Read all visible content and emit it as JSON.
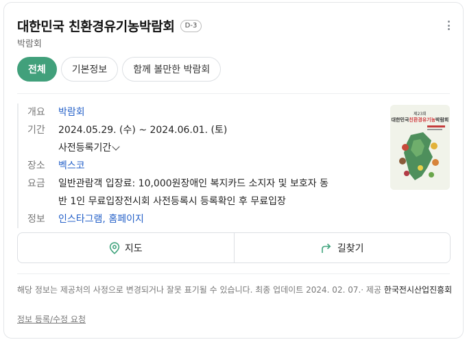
{
  "header": {
    "title": "대한민국 친환경유기농박람회",
    "dday": "D-3",
    "subtitle": "박람회",
    "more_icon": "more-vertical-icon"
  },
  "tabs": [
    {
      "label": "전체",
      "active": true
    },
    {
      "label": "기본정보",
      "active": false
    },
    {
      "label": "함께 볼만한 박람회",
      "active": false
    }
  ],
  "info": {
    "overview": {
      "label": "개요",
      "value": "박람회"
    },
    "period": {
      "label": "기간",
      "value": "2024.05.29. (수) ~  2024.06.01. (토)",
      "sub": "사전등록기간"
    },
    "place": {
      "label": "장소",
      "value": "벡스코"
    },
    "fee": {
      "label": "요금",
      "line1": "일반관람객 입장료: 10,000원장애인 복지카드 소지자 및 보호자 동",
      "line2": "반 1인 무료입장전시회 사전등록시 등록확인 후 무료입장"
    },
    "links": {
      "label": "정보",
      "instagram": "인스타그램",
      "separator": ", ",
      "homepage": "홈페이지"
    }
  },
  "poster": {
    "edition": "제23회",
    "title_a": "대한민국",
    "title_b": "친환경유기농",
    "title_c": "박람회"
  },
  "actions": {
    "map": {
      "label": "지도",
      "icon": "map-pin-icon"
    },
    "directions": {
      "label": "길찾기",
      "icon": "route-arrow-icon"
    }
  },
  "notice": {
    "text": "해당 정보는 제공처의 사정으로 변경되거나 잘못 표기될 수 있습니다. 최종 업데이트 2024. 02. 07.· 제공",
    "source": "한국전시산업진흥회",
    "report": "정보 등록/수정 요청"
  },
  "colors": {
    "accent": "#41a07b",
    "link": "#2460c8"
  }
}
